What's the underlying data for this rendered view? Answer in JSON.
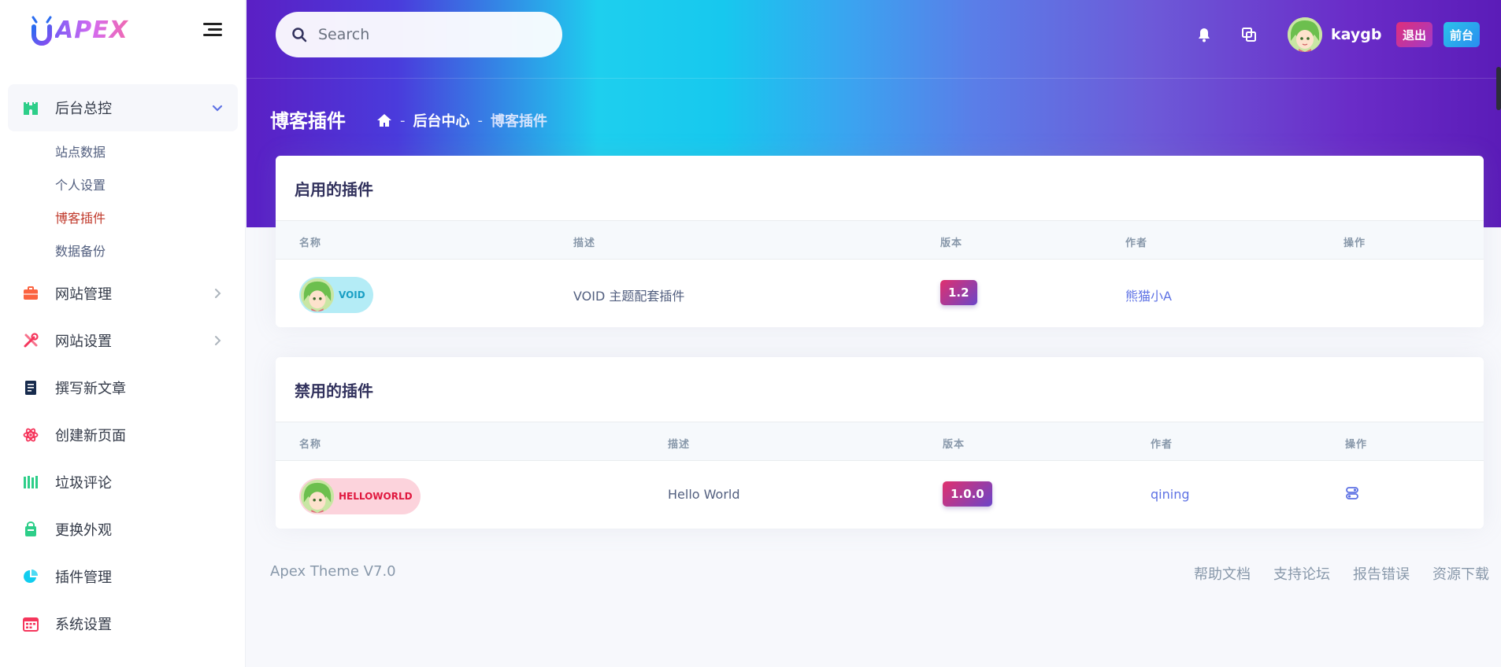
{
  "brand": {
    "name": "APEX"
  },
  "sidebar": {
    "items": [
      {
        "label": "后台总控",
        "icon": "castle-icon",
        "color": "#2dce89",
        "active": true,
        "children": [
          {
            "label": "站点数据"
          },
          {
            "label": "个人设置"
          },
          {
            "label": "博客插件",
            "current": true
          },
          {
            "label": "数据备份"
          }
        ]
      },
      {
        "label": "网站管理",
        "icon": "briefcase-icon",
        "color": "#fb6340"
      },
      {
        "label": "网站设置",
        "icon": "tools-icon",
        "color": "#f5365c"
      },
      {
        "label": "撰写新文章",
        "icon": "document-icon",
        "color": "#172b4d"
      },
      {
        "label": "创建新页面",
        "icon": "atom-icon",
        "color": "#f5365c"
      },
      {
        "label": "垃圾评论",
        "icon": "bars-icon",
        "color": "#2dce89"
      },
      {
        "label": "更换外观",
        "icon": "bag-icon",
        "color": "#2dce89"
      },
      {
        "label": "插件管理",
        "icon": "pie-chart-icon",
        "color": "#11cdef"
      },
      {
        "label": "系统设置",
        "icon": "calendar-icon",
        "color": "#f5365c"
      }
    ]
  },
  "header": {
    "search_placeholder": "Search",
    "username": "kaygb",
    "logout_label": "退出",
    "front_label": "前台"
  },
  "page": {
    "title": "博客插件",
    "breadcrumb": [
      "后台中心",
      "博客插件"
    ]
  },
  "enabled": {
    "title": "启用的插件",
    "columns": [
      "名称",
      "描述",
      "版本",
      "作者",
      "操作"
    ],
    "rows": [
      {
        "name": "VOID",
        "description": "VOID 主题配套插件",
        "version": "1.2",
        "author": "熊猫小A"
      }
    ]
  },
  "disabled": {
    "title": "禁用的插件",
    "columns": [
      "名称",
      "描述",
      "版本",
      "作者",
      "操作"
    ],
    "rows": [
      {
        "name": "HELLOWORLD",
        "description": "Hello World",
        "version": "1.0.0",
        "author": "qining"
      }
    ]
  },
  "footer": {
    "copyright": "Apex Theme V7.0",
    "links": [
      "帮助文档",
      "支持论坛",
      "报告错误",
      "资源下载"
    ]
  }
}
